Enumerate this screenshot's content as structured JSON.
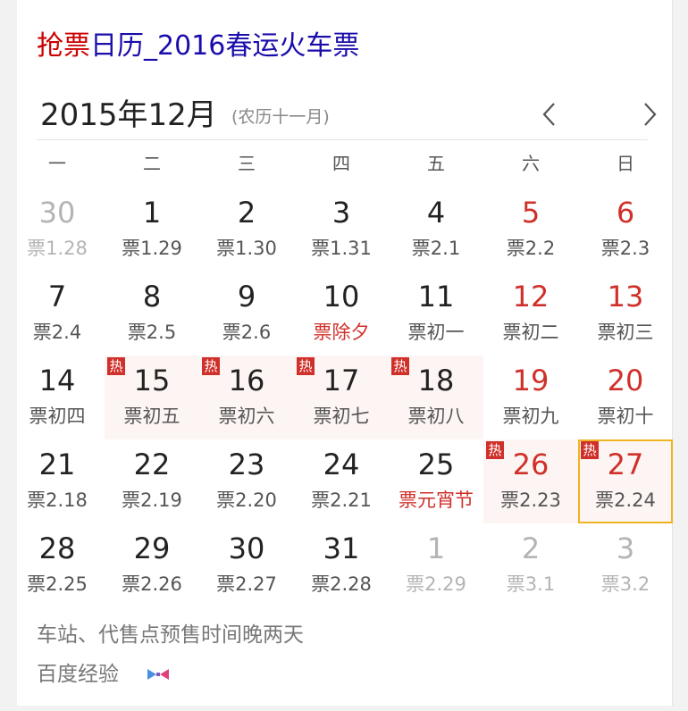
{
  "title": {
    "highlight": "抢票",
    "rest": "日历_2016春运火车票"
  },
  "calendar": {
    "month_title": "2015年12月",
    "lunar_month": "(农历十一月)",
    "prev_icon": "chevron-left-icon",
    "next_icon": "chevron-right-icon",
    "weekdays": [
      "一",
      "二",
      "三",
      "四",
      "五",
      "六",
      "日"
    ],
    "weeks": [
      [
        {
          "day": "30",
          "sub": "票1.28",
          "other_month": true
        },
        {
          "day": "1",
          "sub": "票1.29"
        },
        {
          "day": "2",
          "sub": "票1.30"
        },
        {
          "day": "3",
          "sub": "票1.31"
        },
        {
          "day": "4",
          "sub": "票2.1"
        },
        {
          "day": "5",
          "sub": "票2.2",
          "weekend": true
        },
        {
          "day": "6",
          "sub": "票2.3",
          "weekend": true
        }
      ],
      [
        {
          "day": "7",
          "sub": "票2.4"
        },
        {
          "day": "8",
          "sub": "票2.5"
        },
        {
          "day": "9",
          "sub": "票2.6"
        },
        {
          "day": "10",
          "sub": "票除夕",
          "festival": true
        },
        {
          "day": "11",
          "sub": "票初一"
        },
        {
          "day": "12",
          "sub": "票初二",
          "weekend": true
        },
        {
          "day": "13",
          "sub": "票初三",
          "weekend": true
        }
      ],
      [
        {
          "day": "14",
          "sub": "票初四"
        },
        {
          "day": "15",
          "sub": "票初五",
          "hot": true
        },
        {
          "day": "16",
          "sub": "票初六",
          "hot": true
        },
        {
          "day": "17",
          "sub": "票初七",
          "hot": true
        },
        {
          "day": "18",
          "sub": "票初八",
          "hot": true
        },
        {
          "day": "19",
          "sub": "票初九",
          "weekend": true
        },
        {
          "day": "20",
          "sub": "票初十",
          "weekend": true
        }
      ],
      [
        {
          "day": "21",
          "sub": "票2.18"
        },
        {
          "day": "22",
          "sub": "票2.19"
        },
        {
          "day": "23",
          "sub": "票2.20"
        },
        {
          "day": "24",
          "sub": "票2.21"
        },
        {
          "day": "25",
          "sub": "票元宵节",
          "festival": true
        },
        {
          "day": "26",
          "sub": "票2.23",
          "weekend": true,
          "hot": true
        },
        {
          "day": "27",
          "sub": "票2.24",
          "weekend": true,
          "hot": true,
          "selected": true
        }
      ],
      [
        {
          "day": "28",
          "sub": "票2.25"
        },
        {
          "day": "29",
          "sub": "票2.26"
        },
        {
          "day": "30",
          "sub": "票2.27"
        },
        {
          "day": "31",
          "sub": "票2.28"
        },
        {
          "day": "1",
          "sub": "票2.29",
          "other_month": true
        },
        {
          "day": "2",
          "sub": "票3.1",
          "other_month": true
        },
        {
          "day": "3",
          "sub": "票3.2",
          "other_month": true
        }
      ]
    ],
    "hot_label": "热"
  },
  "footer": {
    "note": "车站、代售点预售时间晚两天",
    "source": "百度经验",
    "source_icon": "bow-tie-icon"
  },
  "colors": {
    "title_highlight": "#cc0000",
    "title_link": "#1a0dab",
    "weekend": "#d0302a",
    "hot_tag": "#d0302a",
    "selected_border": "#f0b321"
  }
}
